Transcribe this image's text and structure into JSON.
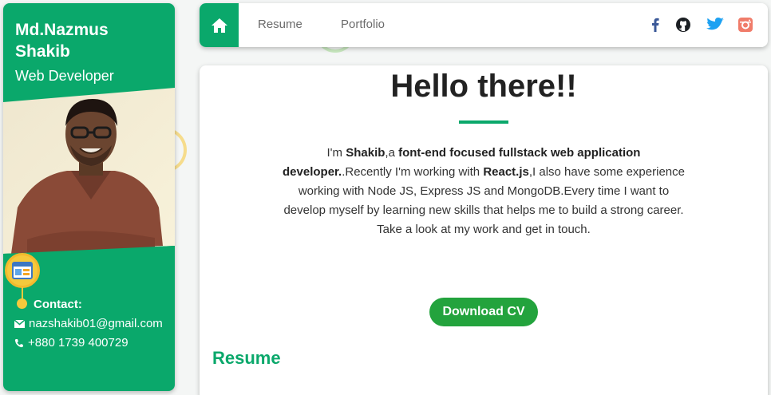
{
  "profile": {
    "name": "Md.Nazmus Shakib",
    "role": "Web Developer",
    "contact_label": "Contact:",
    "email": "nazshakib01@gmail.com",
    "phone": "+880 1739 400729"
  },
  "nav": {
    "links": [
      "Resume",
      "Portfolio"
    ],
    "icons": [
      "home-icon",
      "facebook-icon",
      "github-icon",
      "twitter-icon",
      "instagram-icon"
    ]
  },
  "main": {
    "greeting": "Hello there!!",
    "bio": {
      "p1": "I'm ",
      "name": "Shakib",
      "p2": ",a ",
      "focus": "font-end focused fullstack web application developer.",
      "p3": ".Recently I'm working with ",
      "tech": "React.js",
      "p4": ",I also have some experience working with Node JS, Express JS and MongoDB.Every time I want to develop myself by learning new skills that helps me to build a strong career.",
      "cta": "Take a look at my work and get in touch."
    },
    "download_label": "Download CV",
    "resume_heading": "Resume"
  },
  "colors": {
    "accent": "#0aa86b",
    "button": "#23a33d",
    "badge": "#f5c93c",
    "facebook": "#3b5998",
    "twitter": "#1da1f2",
    "instagram": "#f07c6a"
  }
}
